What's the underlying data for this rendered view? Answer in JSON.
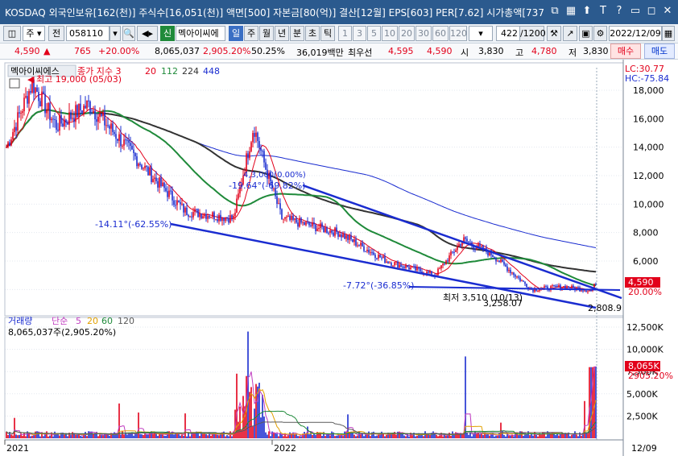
{
  "window": {
    "title": "KOSDAQ 외국인보유[162(천)] 주식수[16,051(천)] 액면[500] 자본금[80(억)] 결산[12월] EPS[603] PER[7.62] 시가총액[737",
    "icons": [
      "restore-icon",
      "grid-icon",
      "pin-icon",
      "font-size-icon",
      "help-icon",
      "minimize-icon",
      "maximize-icon",
      "close-icon"
    ],
    "icon_glyphs": [
      "⧉",
      "▦",
      "⬆",
      "T",
      "?",
      "▭",
      "◻",
      "✕"
    ]
  },
  "toolbar": {
    "market_select": "주",
    "prev_button": "전",
    "code_value": "058110",
    "new_badge": "신",
    "company_name": "멕아이씨에",
    "period_buttons": [
      "일",
      "주",
      "월",
      "년",
      "분",
      "초",
      "틱"
    ],
    "period_active": "일",
    "interval_buttons": [
      "1",
      "3",
      "5",
      "10",
      "20",
      "30",
      "60",
      "120"
    ],
    "count_value": "422",
    "count_max": "/1200",
    "date_value": "2022/12/09"
  },
  "quote": {
    "price": "4,590",
    "change_arrow": "▲",
    "change": "765",
    "change_pct": "+20.00%",
    "volume": "8,065,037",
    "volume_pct": "2,905.20%",
    "ratio": "50.25%",
    "amount": "36,019백만",
    "best_label": "최우선",
    "best_ask": "4,595",
    "best_bid": "4,590",
    "open_label": "시",
    "open": "3,830",
    "high_label": "고",
    "high": "4,780",
    "low_label": "저",
    "low": "3,830",
    "sell_button": "매수",
    "buy_button": "매도"
  },
  "price_panel": {
    "legend_name": "멕아이씨에스",
    "legend_ma_label": "종가 지수 3",
    "ma_periods": [
      "20",
      "112",
      "224",
      "448"
    ],
    "ma_colors": [
      "#e2001a",
      "#1f8a3a",
      "#333333",
      "#1a2cd0"
    ],
    "lc_label": "LC:30.77",
    "hc_label": "HC:-75.84",
    "high_annotation": "최고 19,000 (05/03)",
    "low_annotation": "최저 3,510 (10/13)",
    "trend_labels": [
      "-19.64°(-69.82%)",
      "-14.11°(-62.55%)",
      "-7.72°(-36.85%)"
    ],
    "trend_values": [
      "3,258.07",
      "2,808.9"
    ],
    "top_annotation": "4,3,000(0.00%)",
    "price_tag": "4,590",
    "pct_tag": "20.00%",
    "y_ticks": [
      "18,000",
      "16,000",
      "14,000",
      "12,000",
      "10,000",
      "8,000",
      "6,000",
      "20.00%"
    ],
    "y_tick_values": [
      18000,
      16000,
      14000,
      12000,
      10000,
      8000,
      6000,
      4000
    ]
  },
  "volume_panel": {
    "legend_label": "거래량",
    "legend_ma_label": "단순",
    "ma_periods": [
      "5",
      "20",
      "60",
      "120"
    ],
    "ma_colors": [
      "#c03cc0",
      "#e2a000",
      "#1f8a3a",
      "#5a5a5a"
    ],
    "current_value": "8,065,037주(2,905.20%)",
    "vol_tag": "8,065K",
    "vol_pct_tag": "2905.20%",
    "y_ticks": [
      "12,500K",
      "10,000K",
      "7,500K",
      "5,000K",
      "2,500K"
    ],
    "y_tick_values": [
      12500,
      10000,
      7500,
      5000,
      2500
    ]
  },
  "x_axis": {
    "labels": [
      "2021",
      "2022",
      "12/09"
    ]
  }
}
